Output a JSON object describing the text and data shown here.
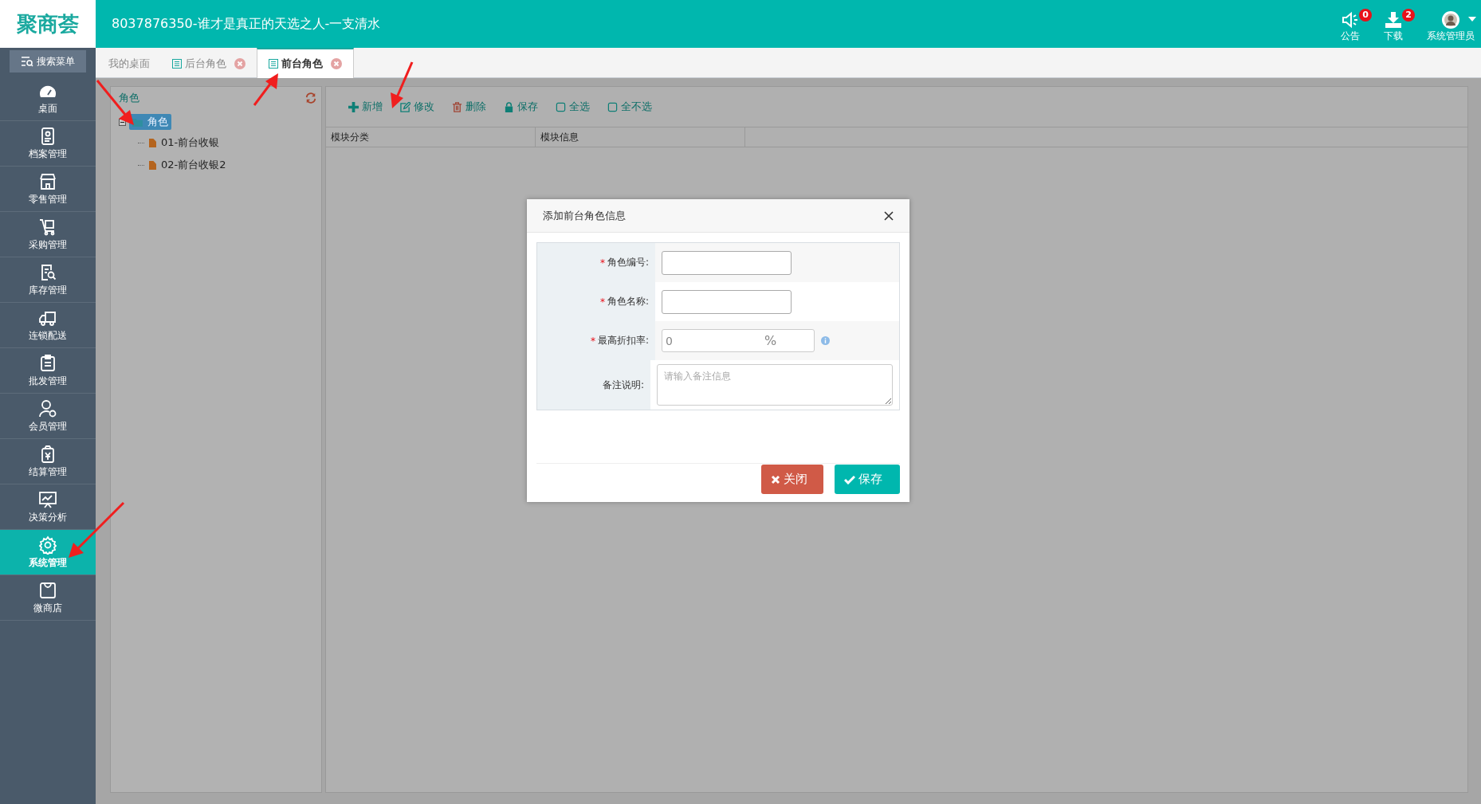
{
  "header": {
    "logo": "聚商荟",
    "title": "8037876350-谁才是真正的天选之人-一支清水",
    "actions": [
      {
        "kind": "notice",
        "label": "公告",
        "badge": "0"
      },
      {
        "kind": "download",
        "label": "下载",
        "badge": "2"
      },
      {
        "kind": "user",
        "label": "系统管理员"
      }
    ]
  },
  "sidebar": {
    "search": "搜索菜单",
    "items": [
      {
        "label": "桌面",
        "selected": false
      },
      {
        "label": "档案管理",
        "selected": false
      },
      {
        "label": "零售管理",
        "selected": false
      },
      {
        "label": "采购管理",
        "selected": false
      },
      {
        "label": "库存管理",
        "selected": false
      },
      {
        "label": "连锁配送",
        "selected": false
      },
      {
        "label": "批发管理",
        "selected": false
      },
      {
        "label": "会员管理",
        "selected": false
      },
      {
        "label": "结算管理",
        "selected": false
      },
      {
        "label": "决策分析",
        "selected": false
      },
      {
        "label": "系统管理",
        "selected": true
      },
      {
        "label": "微商店",
        "selected": false
      }
    ]
  },
  "tabs": [
    {
      "label": "我的桌面",
      "closable": false,
      "selected": false
    },
    {
      "label": "后台角色",
      "closable": true,
      "selected": false
    },
    {
      "label": "前台角色",
      "closable": true,
      "selected": true
    }
  ],
  "tree": {
    "title": "角色",
    "root": {
      "label": "角色",
      "expanded": true,
      "selected": true,
      "children": [
        {
          "label": "01-前台收银"
        },
        {
          "label": "02-前台收银2"
        }
      ]
    }
  },
  "toolbar": [
    {
      "label": "新增"
    },
    {
      "label": "修改"
    },
    {
      "label": "删除"
    },
    {
      "label": "保存"
    },
    {
      "label": "全选"
    },
    {
      "label": "全不选"
    }
  ],
  "grid": {
    "columns": [
      "模块分类",
      "模块信息"
    ]
  },
  "dialog": {
    "title": "添加前台角色信息",
    "fields": [
      {
        "kind": "text",
        "mark": "*",
        "label": "角色编号:"
      },
      {
        "kind": "text",
        "mark": "*",
        "label": "角色名称:"
      },
      {
        "kind": "percent",
        "mark": "*",
        "label": "最高折扣率:",
        "value": "0",
        "unit": "%"
      },
      {
        "kind": "textarea",
        "label": "备注说明:",
        "placeholder": "请输入备注信息"
      }
    ],
    "buttons": [
      {
        "kind": "close",
        "label": "关闭"
      },
      {
        "kind": "save",
        "label": "保存"
      }
    ]
  }
}
